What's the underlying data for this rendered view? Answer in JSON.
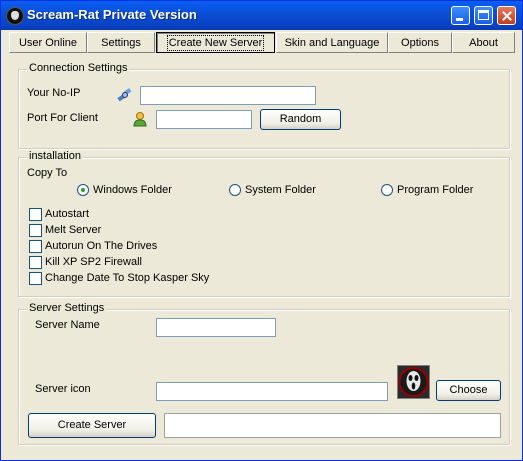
{
  "window": {
    "title": "Scream-Rat Private Version"
  },
  "tabs": [
    {
      "label": "User Online"
    },
    {
      "label": "Settings"
    },
    {
      "label": "Create New Server"
    },
    {
      "label": "Skin and  Language"
    },
    {
      "label": "Options"
    },
    {
      "label": "About"
    }
  ],
  "connection": {
    "group_label": "Connection Settings",
    "noip_label": "Your No-IP",
    "noip_value": "",
    "port_label": "Port For Client",
    "port_value": "",
    "random_button": "Random"
  },
  "installation": {
    "group_label": "installation",
    "copy_to_label": "Copy To",
    "radios": [
      {
        "label": "Windows Folder",
        "selected": true
      },
      {
        "label": "System Folder",
        "selected": false
      },
      {
        "label": "Program Folder",
        "selected": false
      }
    ],
    "checkboxes": [
      {
        "label": "Autostart",
        "checked": false
      },
      {
        "label": "Melt Server",
        "checked": false
      },
      {
        "label": "Autorun On The Drives",
        "checked": false
      },
      {
        "label": "Kill XP SP2 Firewall",
        "checked": false
      },
      {
        "label": "Change Date To Stop Kasper Sky",
        "checked": false
      }
    ]
  },
  "server": {
    "group_label": "Server Settings",
    "name_label": "Server Name",
    "name_value": "",
    "icon_label": "Server icon",
    "icon_path_value": "",
    "choose_button": "Choose",
    "create_button": "Create Server",
    "status_value": ""
  },
  "icons": {
    "app": "scream-mask-icon",
    "noip": "satellite-icon",
    "port": "user-icon",
    "server": "scream-mask-icon"
  }
}
